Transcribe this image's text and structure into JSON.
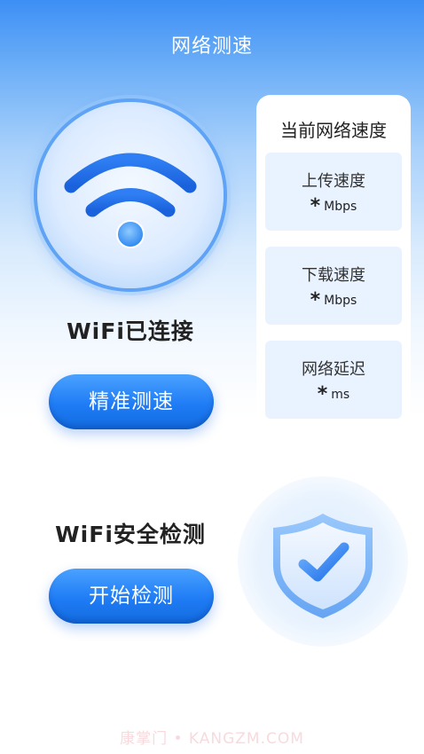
{
  "header": {
    "title": "网络测速"
  },
  "wifi": {
    "status": "WiFi已连接",
    "button_label": "精准测速"
  },
  "speed_panel": {
    "title": "当前网络速度",
    "metrics": [
      {
        "label": "上传速度",
        "value": "*",
        "unit": "Mbps"
      },
      {
        "label": "下载速度",
        "value": "*",
        "unit": "Mbps"
      },
      {
        "label": "网络延迟",
        "value": "*",
        "unit": "ms"
      }
    ]
  },
  "security": {
    "title": "WiFi安全检测",
    "button_label": "开始检测"
  },
  "watermark": "康掌门 • KANGZM.COM",
  "colors": {
    "accent": "#1f7cf5",
    "header_blue": "#3d8ff5",
    "metric_bg": "#e9f3ff"
  }
}
